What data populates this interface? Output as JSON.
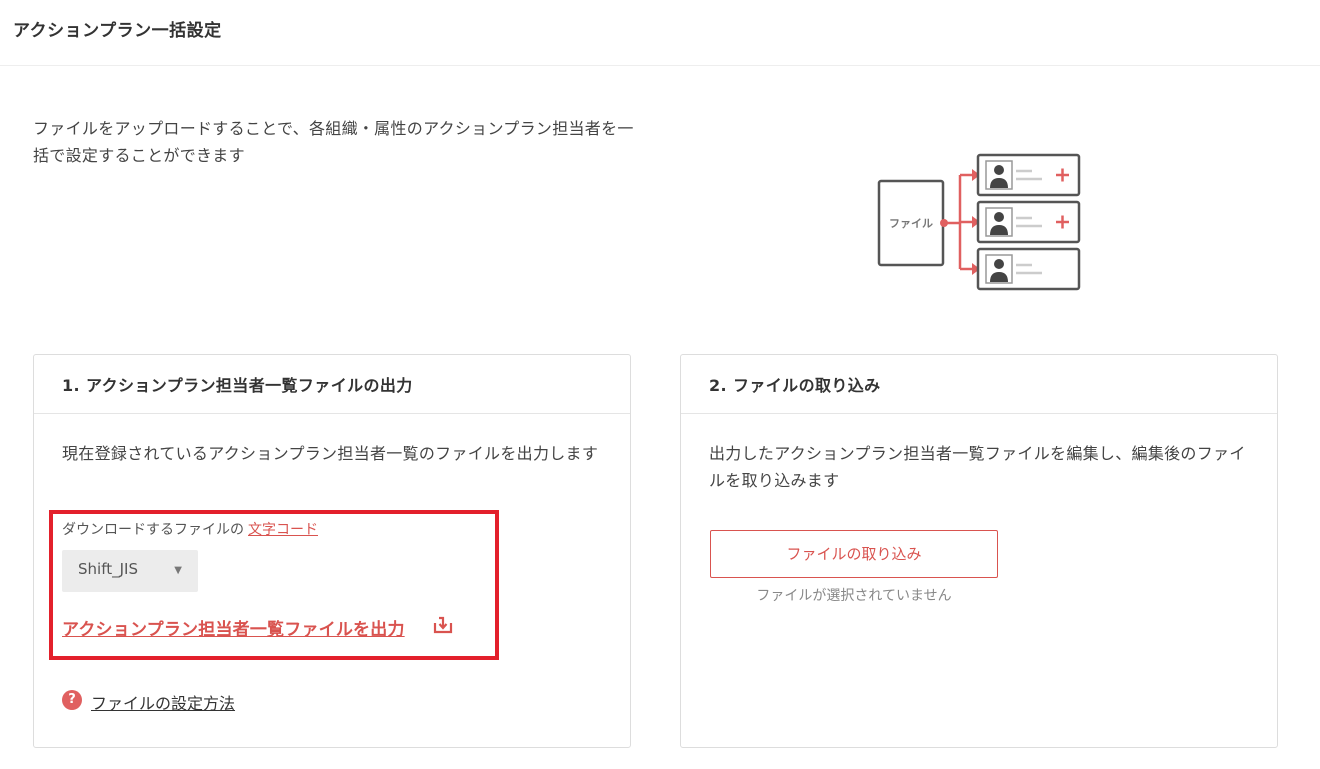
{
  "header": {
    "title": "アクションプラン一括設定"
  },
  "intro": {
    "text": "ファイルをアップロードすることで、各組織・属性のアクションプラン担当者を一括で設定することができます"
  },
  "illustration": {
    "file_label": "ファイル",
    "accent_color": "#e06060",
    "rows": 3
  },
  "export_card": {
    "title": "1. アクションプラン担当者一覧ファイルの出力",
    "description": "現在登録されているアクションプラン担当者一覧のファイルを出力します",
    "encoding_label": "ダウンロードするファイルの",
    "encoding_link": "文字コード",
    "encoding_value": "Shift_JIS",
    "export_link": "アクションプラン担当者一覧ファイルを出力",
    "help_link": "ファイルの設定方法",
    "help_icon_glyph": "?"
  },
  "import_card": {
    "title": "2. ファイルの取り込み",
    "description": "出力したアクションプラン担当者一覧ファイルを編集し、編集後のファイルを取り込みます",
    "button_label": "ファイルの取り込み",
    "status_text": "ファイルが選択されていません"
  },
  "colors": {
    "accent": "#d9534f",
    "highlight": "#e3202b"
  }
}
